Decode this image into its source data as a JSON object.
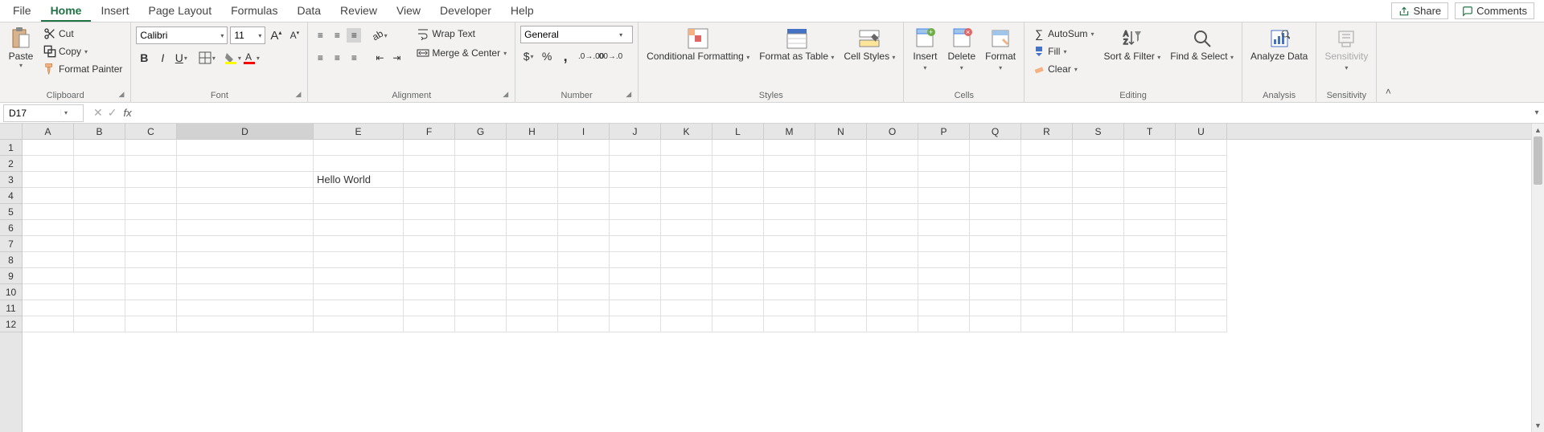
{
  "tabs": {
    "items": [
      "File",
      "Home",
      "Insert",
      "Page Layout",
      "Formulas",
      "Data",
      "Review",
      "View",
      "Developer",
      "Help"
    ],
    "active": "Home",
    "share": "Share",
    "comments": "Comments"
  },
  "ribbon": {
    "clipboard": {
      "label": "Clipboard",
      "paste": "Paste",
      "cut": "Cut",
      "copy": "Copy",
      "format_painter": "Format Painter"
    },
    "font": {
      "label": "Font",
      "name": "Calibri",
      "size": "11"
    },
    "alignment": {
      "label": "Alignment",
      "wrap": "Wrap Text",
      "merge": "Merge & Center"
    },
    "number": {
      "label": "Number",
      "format": "General"
    },
    "styles": {
      "label": "Styles",
      "conditional": "Conditional Formatting",
      "format_table": "Format as Table",
      "cell_styles": "Cell Styles"
    },
    "cells": {
      "label": "Cells",
      "insert": "Insert",
      "delete": "Delete",
      "format": "Format"
    },
    "editing": {
      "label": "Editing",
      "autosum": "AutoSum",
      "fill": "Fill",
      "clear": "Clear",
      "sort": "Sort & Filter",
      "find": "Find & Select"
    },
    "analysis": {
      "label": "Analysis",
      "analyze": "Analyze Data"
    },
    "sensitivity": {
      "label": "Sensitivity",
      "btn": "Sensitivity"
    }
  },
  "namebox": {
    "value": "D17"
  },
  "formula": {
    "value": ""
  },
  "grid": {
    "columns": [
      "A",
      "B",
      "C",
      "D",
      "E",
      "F",
      "G",
      "H",
      "I",
      "J",
      "K",
      "L",
      "M",
      "N",
      "O",
      "P",
      "Q",
      "R",
      "S",
      "T",
      "U"
    ],
    "col_widths": {
      "default": 64,
      "D": 170,
      "E": 112
    },
    "visible_rows": 12,
    "selected_col": "D",
    "cells": {
      "E3": "Hello World"
    }
  }
}
